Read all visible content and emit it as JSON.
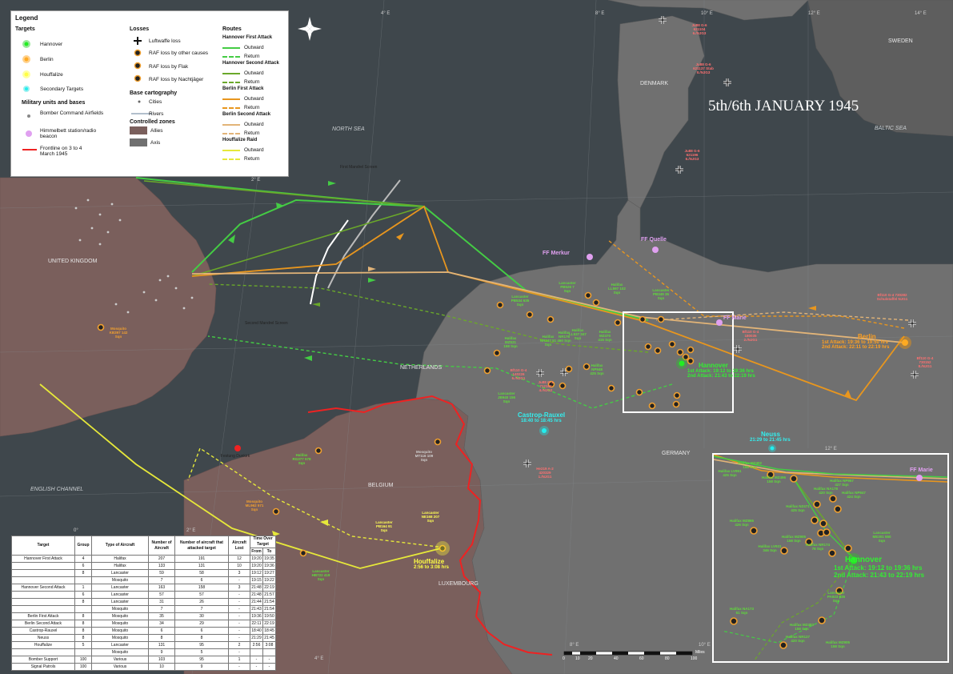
{
  "title": "5th/6th JANUARY 1945",
  "legend": {
    "heading": "Legend",
    "targets_heading": "Targets",
    "targets": [
      "Hannover",
      "Berlin",
      "Houffalize",
      "Secondary Targets"
    ],
    "military_heading": "Military units and bases",
    "military": [
      "Bomber Command Airfields",
      "Himmelbett station/radio beacon",
      "Frontline on 3 to 4 March 1945"
    ],
    "losses_heading": "Losses",
    "losses": [
      "Luftwaffe loss",
      "RAF loss by other causes",
      "RAF loss by Flak",
      "RAF loss by Nachtjäger"
    ],
    "base_heading": "Base cartography",
    "base": [
      "Cities",
      "Rivers"
    ],
    "zones_heading": "Controlled zones",
    "zones": [
      "Allies",
      "Axis"
    ],
    "routes_heading": "Routes",
    "route_groups": [
      {
        "name": "Hannover First Attack",
        "outward": "Outward",
        "return": "Return"
      },
      {
        "name": "Hannover Second Attack",
        "outward": "Outward",
        "return": "Return"
      },
      {
        "name": "Berlin First Attack",
        "outward": "Outward",
        "return": "Return"
      },
      {
        "name": "Berlin Second Attack",
        "outward": "Outward",
        "return": "Return"
      },
      {
        "name": "Houffalize Raid",
        "outward": "Outward",
        "return": "Return"
      }
    ]
  },
  "colors": {
    "sea": "#3f474c",
    "allies": "#7a5f5c",
    "axis": "#707070",
    "neutral": "#5e5e5e",
    "hannover": "#22cc22",
    "berlin": "#ff9900",
    "houffalize": "#ffff33",
    "secondary": "#22dddd",
    "frontline": "#ee2222",
    "beacon": "#e0a0f0",
    "h1": "#44cc44",
    "h2": "#6aa82a",
    "b1": "#e8961e",
    "b2": "#e2b478",
    "hf": "#e6e83a"
  },
  "sea_labels": [
    "NORTH SEA",
    "BALTIC SEA",
    "ENGLISH CHANNEL"
  ],
  "country_labels": [
    "UNITED KINGDOM",
    "DENMARK",
    "SWEDEN",
    "NETHERLANDS",
    "BELGIUM",
    "GERMANY",
    "LUXEMBOURG"
  ],
  "grid_labels": [
    "4° E",
    "6° E",
    "8° E",
    "10° E",
    "12° E",
    "14° E",
    "2° E",
    "6° E",
    "8° E",
    "10° E",
    "4° E",
    "12° E",
    "55° N",
    "53° N",
    "51° N",
    "50° N",
    "0°",
    "2° E"
  ],
  "targets": [
    {
      "name": "Hannover",
      "line1": "1st Attack: 19:12 to 19:36 hrs",
      "line2": "2nd Attack: 21:43 to 22:19 hrs"
    },
    {
      "name": "Berlin",
      "line1": "1st Attack: 19:36 to 19:50 hrs",
      "line2": "2nd Attack: 22:11 to 22:19 hrs"
    },
    {
      "name": "Houffalize",
      "line1": "2:56 to 3:08 hrs"
    },
    {
      "name": "Castrop-Rauxel",
      "line1": "18:40 to 18:45 hrs"
    },
    {
      "name": "Neuss",
      "line1": "21:29 to 21:45 hrs"
    }
  ],
  "beacons": [
    "FF Merkur",
    "FF Quelle",
    "FF Marie"
  ],
  "route_notes": [
    "First Mandrel Screen",
    "Second Mandrel Screen"
  ],
  "places": [
    "Festung Dunkirk"
  ],
  "inset": {
    "target": "Hannover",
    "line1": "1st Attack: 19:12 to 19:36 hrs",
    "line2": "2nd Attack: 21:43 to 22:19 hrs",
    "beacon": "FF Marie"
  },
  "scale": {
    "unit": "Miles",
    "ticks": [
      "0",
      "10",
      "20",
      "40",
      "60",
      "80",
      "100"
    ]
  },
  "table": {
    "headers": [
      "Target",
      "Group",
      "Type of Aircraft",
      "Number of Aircraft",
      "Number of aircraft that attacked target",
      "Aircraft Lost",
      "Time Over Target"
    ],
    "subheaders": [
      "From",
      "To"
    ],
    "rows": [
      {
        "target": "Hannover First Attack",
        "group": "4",
        "type": "Halifax",
        "n": "207",
        "att": "191",
        "lost": "12",
        "from": "19:20",
        "to": "19:35"
      },
      {
        "target": "",
        "group": "6",
        "type": "Halifax",
        "n": "133",
        "att": "131",
        "lost": "10",
        "from": "19:20",
        "to": "19:36"
      },
      {
        "target": "",
        "group": "8",
        "type": "Lancaster",
        "n": "59",
        "att": "58",
        "lost": "3",
        "from": "19:12",
        "to": "19:27"
      },
      {
        "target": "",
        "group": "",
        "type": "Mosquito",
        "n": "7",
        "att": "6",
        "lost": "-",
        "from": "19:15",
        "to": "19:22"
      },
      {
        "target": "Hannover Second Attack",
        "group": "1",
        "type": "Lancaster",
        "n": "163",
        "att": "158",
        "lost": "3",
        "from": "21:48",
        "to": "22:19"
      },
      {
        "target": "",
        "group": "6",
        "type": "Lancaster",
        "n": "57",
        "att": "57",
        "lost": "-",
        "from": "21:48",
        "to": "21:57"
      },
      {
        "target": "",
        "group": "8",
        "type": "Lancaster",
        "n": "31",
        "att": "26",
        "lost": "-",
        "from": "21:44",
        "to": "21:54"
      },
      {
        "target": "",
        "group": "",
        "type": "Mosquito",
        "n": "7",
        "att": "7",
        "lost": "-",
        "from": "21:43",
        "to": "21:54"
      },
      {
        "target": "Berlin First Attack",
        "group": "8",
        "type": "Mosquito",
        "n": "35",
        "att": "30",
        "lost": "-",
        "from": "19:36",
        "to": "19:50"
      },
      {
        "target": "Berlin Second Attack",
        "group": "8",
        "type": "Mosquito",
        "n": "34",
        "att": "29",
        "lost": "-",
        "from": "22:11",
        "to": "22:19"
      },
      {
        "target": "Castrop-Rauxel",
        "group": "8",
        "type": "Mosquito",
        "n": "6",
        "att": "6",
        "lost": "-",
        "from": "18:40",
        "to": "18:45"
      },
      {
        "target": "Neuss",
        "group": "8",
        "type": "Mosquito",
        "n": "8",
        "att": "8",
        "lost": "-",
        "from": "21:29",
        "to": "21:45"
      },
      {
        "target": "Houffalize",
        "group": "5",
        "type": "Lancaster",
        "n": "131",
        "att": "95",
        "lost": "2",
        "from": "2:56",
        "to": "3:08"
      },
      {
        "target": "",
        "group": "",
        "type": "Mosquito",
        "n": "9",
        "att": "5",
        "lost": "-",
        "from": "",
        "to": ""
      },
      {
        "target": "Bomber Support",
        "group": "100",
        "type": "Various",
        "n": "103",
        "att": "95",
        "lost": "1",
        "from": "-",
        "to": "-"
      },
      {
        "target": "Signal Patrols",
        "group": "100",
        "type": "Various",
        "n": "10",
        "att": "9",
        "lost": "-",
        "from": "-",
        "to": "-"
      }
    ]
  },
  "loss_notes_green": [
    "Lancaster PB526 7 Sqn",
    "Halifax LL597 102 Sqn",
    "Lancaster PB349 35 Sqn",
    "Lancaster PB534 635 Sqn",
    "Halifax NR176 460 Sqn",
    "Halifax MZ470 415 Sqn",
    "Halifax NP948 425 Sqn",
    "Halifax MZ531 158 Sqn",
    "Halifax NR247 51 Sqn",
    "Halifax LL537 347 Sqn",
    "Lancaster JB940 156 Sqn",
    "Halifax NR348 158 Sqn",
    "Halifax RG377 578 Sqn",
    "Mosquito MT116 109 Sqn",
    "Lancaster PB164 91 Sqn",
    "Lancaster HB722 419 Sqn"
  ],
  "loss_notes_orange": [
    "Mosquito KB397 142 Sqn",
    "Mosquito ML962 571 Sqn",
    "Lancaster NE168 207 Sqn"
  ],
  "loss_notes_red": [
    "Ju88 G-6 621104 6./NJG3",
    "Ju88 G-6 621137 Stab II./NJG3",
    "Ju88 G-6 621196 6./NJG3",
    "Bf110 G-4 730282 Schulstaffel NJG1",
    "Bf110 G-4 180035 2./NJG1",
    "Bf110 G-4 730152 8./NJG1",
    "Ju88 G-1 712162 4./NJG2",
    "Bf110 G-4 140226 6./NJG1",
    "He219 A-2 420329 1./NJG1",
    "Bf110 G-4 180226 1./NJG1"
  ],
  "inset_notes": [
    "Halifax MZ402 158 Sqn",
    "Halifax LV951 425 Sqn",
    "Halifax MZ496 158 Sqn",
    "Halifax NP957 427 Sqn",
    "Halifax NA178 420 Sqn",
    "Halifax MZ865 426 Sqn",
    "Halifax NP847 424 Sqn",
    "Halifax NZ471 425 Sqn",
    "Halifax NR174 78 Sqn",
    "Halifax MZ905 158 Sqn",
    "Halifax LV931 346 Sqn",
    "Lancaster ME301 550 Sqn",
    "Halifax NA173 51 Sqn",
    "Lancaster PA923 635 Sqn",
    "Halifax MZ483 158 Sqn",
    "Halifax NR127 420 Sqn",
    "Halifax MZ905 158 Sqn"
  ]
}
